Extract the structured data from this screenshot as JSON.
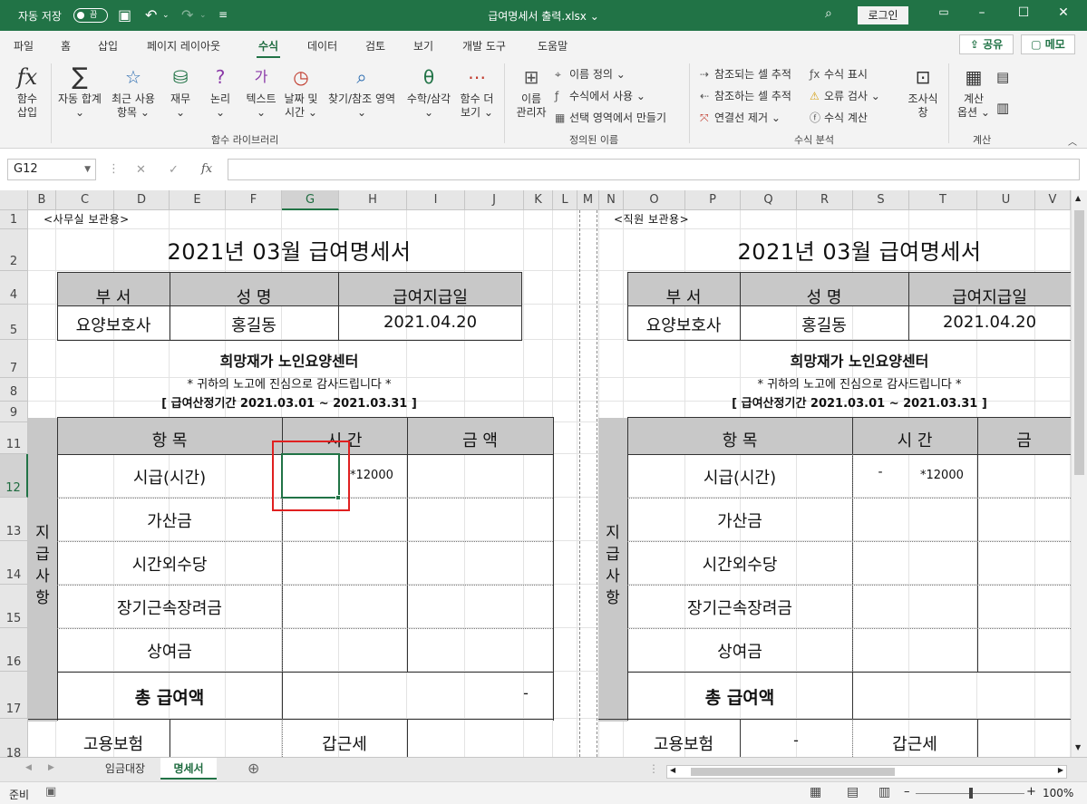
{
  "titlebar": {
    "autosave_label": "자동 저장",
    "autosave_state": "끔",
    "document_title": "급여명세서 출력.xlsx",
    "login_label": "로그인"
  },
  "ribbon_tabs": [
    "파일",
    "홈",
    "삽입",
    "페이지 레이아웃",
    "수식",
    "데이터",
    "검토",
    "보기",
    "개발 도구",
    "도움말"
  ],
  "active_tab": "수식",
  "share_label": "공유",
  "memo_label": "메모",
  "ribbon": {
    "insert_function": [
      "함수",
      "삽입"
    ],
    "library": {
      "autosum": [
        "자동 합계",
        "⌄"
      ],
      "recent": [
        "최근 사용",
        "항목 ⌄"
      ],
      "financial": [
        "재무",
        "⌄"
      ],
      "logical": [
        "논리",
        "⌄"
      ],
      "text": [
        "텍스트",
        "⌄"
      ],
      "datetime": [
        "날짜 및",
        "시간 ⌄"
      ],
      "lookup": [
        "찾기/참조 영역",
        "⌄"
      ],
      "math": [
        "수학/삼각",
        "⌄"
      ],
      "more": [
        "함수 더",
        "보기 ⌄"
      ],
      "group_label": "함수 라이브러리"
    },
    "names": {
      "manager": [
        "이름",
        "관리자"
      ],
      "define": "이름 정의 ⌄",
      "use_in_formula": "수식에서 사용 ⌄",
      "create_from_selection": "선택 영역에서 만들기",
      "group_label": "정의된 이름"
    },
    "auditing": {
      "trace_precedents": "참조되는 셀 추적",
      "trace_dependents": "참조하는 셀 추적",
      "remove_arrows": "연결선 제거 ⌄",
      "show_formulas": "수식 표시",
      "error_checking": "오류 검사 ⌄",
      "evaluate": "수식 계산",
      "watch_window": [
        "조사식",
        "창"
      ],
      "group_label": "수식 분석"
    },
    "calculation": {
      "options": [
        "계산",
        "옵션 ⌄"
      ],
      "group_label": "계산"
    }
  },
  "formula_bar": {
    "name_box": "G12",
    "fx": "fx",
    "value": ""
  },
  "columns": [
    {
      "label": "B",
      "sel": false
    },
    {
      "label": "C",
      "sel": false
    },
    {
      "label": "D",
      "sel": false
    },
    {
      "label": "E",
      "sel": false
    },
    {
      "label": "F",
      "sel": false
    },
    {
      "label": "G",
      "sel": true
    },
    {
      "label": "H",
      "sel": false
    },
    {
      "label": "I",
      "sel": false
    },
    {
      "label": "J",
      "sel": false
    },
    {
      "label": "K",
      "sel": false
    },
    {
      "label": "L",
      "sel": false
    },
    {
      "label": "M",
      "sel": false
    },
    {
      "label": "N",
      "sel": false
    },
    {
      "label": "O",
      "sel": false
    },
    {
      "label": "P",
      "sel": false
    },
    {
      "label": "Q",
      "sel": false
    },
    {
      "label": "R",
      "sel": false
    },
    {
      "label": "S",
      "sel": false
    },
    {
      "label": "T",
      "sel": false
    },
    {
      "label": "U",
      "sel": false
    },
    {
      "label": "V",
      "sel": false
    }
  ],
  "rows": [
    {
      "label": "1",
      "sel": false
    },
    {
      "label": "2",
      "sel": false
    },
    {
      "label": "4",
      "sel": false
    },
    {
      "label": "5",
      "sel": false
    },
    {
      "label": "7",
      "sel": false
    },
    {
      "label": "8",
      "sel": false
    },
    {
      "label": "9",
      "sel": false
    },
    {
      "label": "11",
      "sel": false
    },
    {
      "label": "12",
      "sel": true
    },
    {
      "label": "13",
      "sel": false
    },
    {
      "label": "14",
      "sel": false
    },
    {
      "label": "15",
      "sel": false
    },
    {
      "label": "16",
      "sel": false
    },
    {
      "label": "17",
      "sel": false
    },
    {
      "label": "18",
      "sel": false
    }
  ],
  "left_slip": {
    "copy_label": "<사무실 보관용>",
    "title": "2021년 03월 급여명세서",
    "head_dept": "부   서",
    "head_name": "성    명",
    "head_paydate": "급여지급일",
    "dept": "요양보호사",
    "name": "홍길동",
    "paydate": "2021.04.20",
    "org": "희망재가 노인요양센터",
    "thanks": "* 귀하의 노고에 진심으로 감사드립니다 *",
    "period": "[ 급여산정기간 2021.03.01 ~ 2021.03.31 ]",
    "section": [
      "지",
      "급",
      "사",
      "항"
    ],
    "col_item": "항  목",
    "col_time": "시  간",
    "col_amount": "금    액",
    "items": [
      "시급(시간)",
      "가산금",
      "시간외수당",
      "장기근속장려금",
      "상여금"
    ],
    "hourly_time": "",
    "hourly_rate": "*12000",
    "total_label": "총 급여액",
    "total_value": "-",
    "insurance": "고용보험",
    "insurance_value": "",
    "tax": "갑근세"
  },
  "right_slip": {
    "copy_label": "<직원 보관용>",
    "title": "2021년 03월 급여명세서",
    "head_dept": "부   서",
    "head_name": "성    명",
    "head_paydate": "급여지급일",
    "dept": "요양보호사",
    "name": "홍길동",
    "paydate": "2021.04.20",
    "org": "희망재가 노인요양센터",
    "thanks": "* 귀하의 노고에 진심으로 감사드립니다 *",
    "period": "[ 급여산정기간 2021.03.01 ~ 2021.03.31 ]",
    "section": [
      "지",
      "급",
      "사",
      "항"
    ],
    "col_item": "항  목",
    "col_time": "시  간",
    "col_amount": "금",
    "items": [
      "시급(시간)",
      "가산금",
      "시간외수당",
      "장기근속장려금",
      "상여금"
    ],
    "hourly_time": "-",
    "hourly_rate": "*12000",
    "total_label": "총 급여액",
    "insurance": "고용보험",
    "insurance_value": "-",
    "tax": "갑근세"
  },
  "sheets": {
    "tab1": "임금대장",
    "tab2": "명세서",
    "active": "명세서"
  },
  "status": {
    "ready": "준비",
    "zoom": "100%"
  }
}
